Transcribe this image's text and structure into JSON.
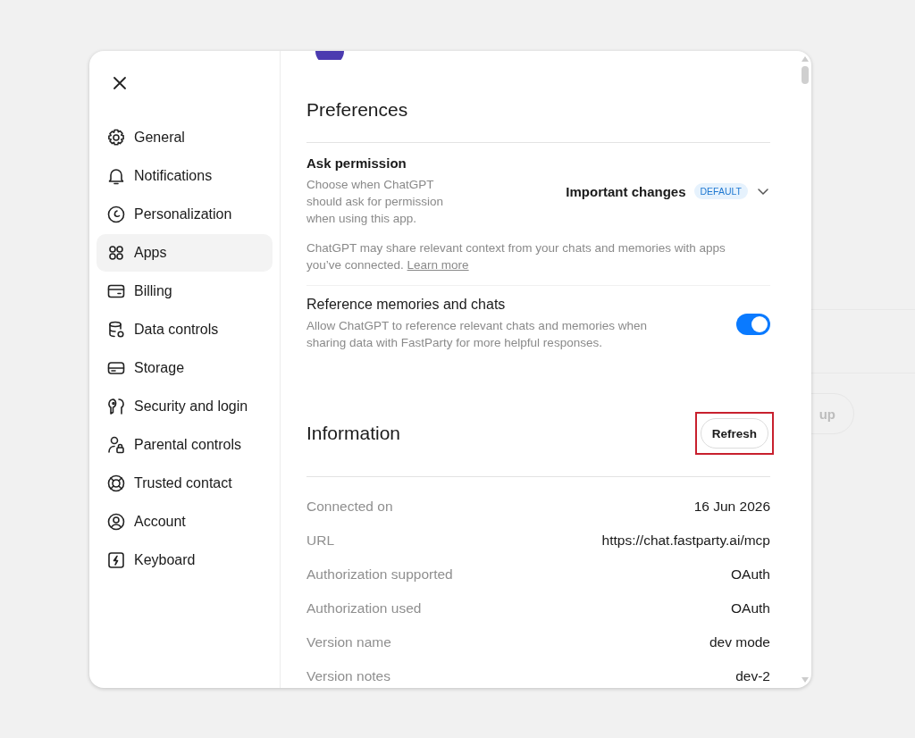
{
  "background": {
    "button_text": "up"
  },
  "sidebar": {
    "items": [
      {
        "label": "General",
        "selected": false
      },
      {
        "label": "Notifications",
        "selected": false
      },
      {
        "label": "Personalization",
        "selected": false
      },
      {
        "label": "Apps",
        "selected": true
      },
      {
        "label": "Billing",
        "selected": false
      },
      {
        "label": "Data controls",
        "selected": false
      },
      {
        "label": "Storage",
        "selected": false
      },
      {
        "label": "Security and login",
        "selected": false
      },
      {
        "label": "Parental controls",
        "selected": false
      },
      {
        "label": "Trusted contact",
        "selected": false
      },
      {
        "label": "Account",
        "selected": false
      },
      {
        "label": "Keyboard",
        "selected": false
      }
    ]
  },
  "preferences": {
    "title": "Preferences",
    "ask_permission": {
      "title": "Ask permission",
      "description": "Choose when ChatGPT should ask for permission when using this app.",
      "value": "Important changes",
      "badge": "DEFAULT"
    },
    "note": {
      "text": "ChatGPT may share relevant context from your chats and memories with apps you’ve connected.",
      "link": "Learn more"
    },
    "reference": {
      "title": "Reference memories and chats",
      "description": "Allow ChatGPT to reference relevant chats and memories when sharing data with FastParty for more helpful responses.",
      "on": true
    }
  },
  "information": {
    "title": "Information",
    "refresh": {
      "label": "Refresh",
      "highlighted": true
    },
    "rows": [
      {
        "label": "Connected on",
        "value": "16 Jun 2026"
      },
      {
        "label": "URL",
        "value": "https://chat.fastparty.ai/mcp"
      },
      {
        "label": "Authorization supported",
        "value": "OAuth"
      },
      {
        "label": "Authorization used",
        "value": "OAuth"
      },
      {
        "label": "Version name",
        "value": "dev mode"
      },
      {
        "label": "Version notes",
        "value": "dev-2"
      }
    ]
  }
}
